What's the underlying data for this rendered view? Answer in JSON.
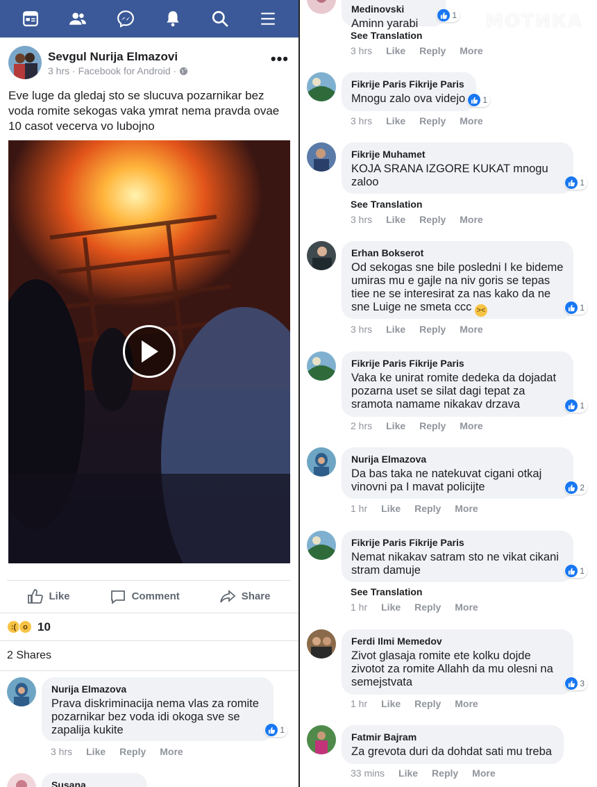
{
  "post": {
    "author": "Sevgul Nurija Elmazovi",
    "meta": "3 hrs · Facebook for Android ·",
    "text": "Eve luge da gledaj sto se slucuva pozarnikar bez voda romite sekogas vaka ymrat nema pravda ovae 10 casot vecerva vo lubojno",
    "actions": {
      "like": "Like",
      "comment": "Comment",
      "share": "Share"
    },
    "reaction_count": "10",
    "shares": "2 Shares"
  },
  "left_comments": [
    {
      "author": "Nurija Elmazova",
      "text": "Prava diskriminacija nema vlas za romite pozarnikar bez voda idi okoga sve se zapalija kukite",
      "likes": "1",
      "time": "3 hrs"
    },
    {
      "author": "Susana Medinovski"
    }
  ],
  "right_comments": [
    {
      "author": "Susana Medinovski",
      "text": "Aminn yarabi",
      "likes": "1",
      "see_translation": "See Translation",
      "time": "3 hrs"
    },
    {
      "author": "Fikrije Paris Fikrije Paris",
      "text": "Mnogu zalo ova videjo",
      "likes": "1",
      "time": "3 hrs"
    },
    {
      "author": "Fikrije Muhamet",
      "text": "KOJA SRANA IZGORE KUKAT mnogu zaloo",
      "likes": "1",
      "see_translation": "See Translation",
      "time": "3 hrs"
    },
    {
      "author": "Erhan Bokserot",
      "text": "Od sekogas sne bile posledni I ke bideme umiras mu e gajle na niv goris se tepas tiee ne se interesirat za nas kako da ne sne Luige ne smeta ccc",
      "likes": "1",
      "time": "3 hrs"
    },
    {
      "author": "Fikrije Paris Fikrije Paris",
      "text": "Vaka ke unirat romite dedeka da dojadat pozarna uset se silat dagi tepat za sramota namame nikakav drzava",
      "likes": "1",
      "time": "2 hrs"
    },
    {
      "author": "Nurija Elmazova",
      "text": "Da bas taka ne natekuvat cigani otkaj vinovni pa I mavat policijte",
      "likes": "2",
      "time": "1 hr"
    },
    {
      "author": "Fikrije Paris Fikrije Paris",
      "text": "Nemat nikakav satram sto ne vikat cikani stram damuje",
      "likes": "1",
      "see_translation": "See Translation",
      "time": "1 hr"
    },
    {
      "author": "Ferdi Ilmi Memedov",
      "text": "Zivot glasaja romite ete kolku dojde zivotot za romite Allahh da mu olesni na semejstvata",
      "likes": "3",
      "time": "1 hr"
    },
    {
      "author": "Fatmir Bajram",
      "text": "Za grevota duri da dohdat sati mu treba",
      "time": "33 mins"
    }
  ],
  "comment_actions": {
    "like": "Like",
    "reply": "Reply",
    "more": "More"
  },
  "watermark": "МОТИКА",
  "colors": {
    "nav": "#3b5998",
    "like_blue": "#1877f2",
    "bubble": "#f0f2f5"
  }
}
